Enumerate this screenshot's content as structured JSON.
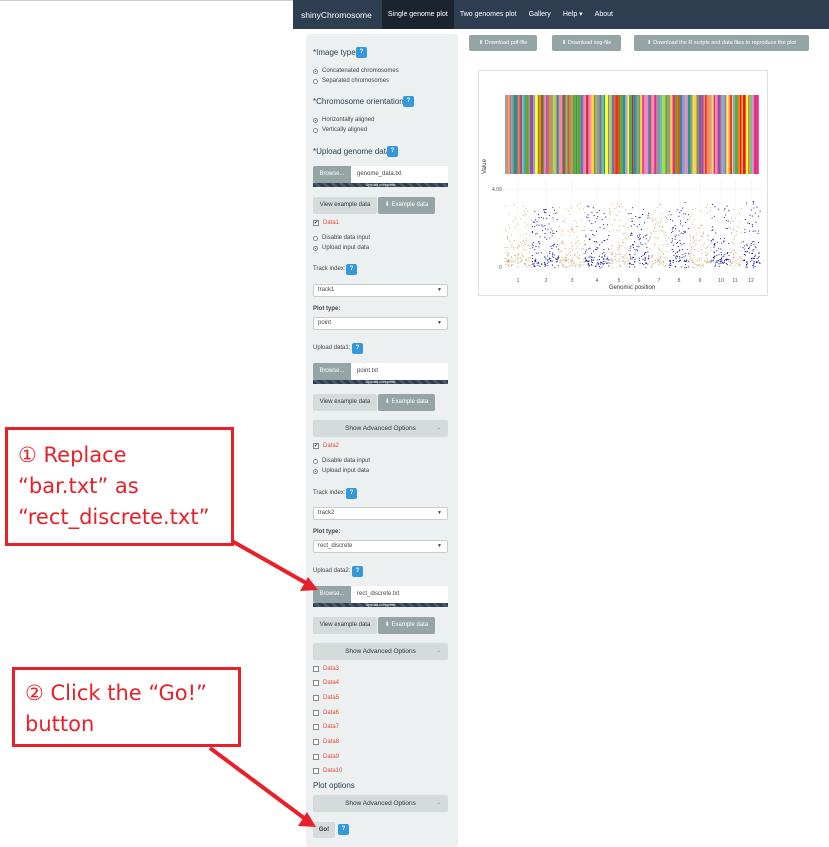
{
  "navbar": {
    "brand": "shinyChromosome",
    "items": [
      "Single genome plot",
      "Two genomes plot",
      "Gallery",
      "Help ▾",
      "About"
    ]
  },
  "sidebar": {
    "image_type_label": "*Image type",
    "image_type_options": [
      "Concatenated chromosomes",
      "Separated chromosomes"
    ],
    "orientation_label": "*Chromosome orientation",
    "orientation_options": [
      "Horizontally aligned",
      "Vertically aligned"
    ],
    "upload_genome_label": "*Upload genome data",
    "genome_file": "genome_data.txt",
    "browse_label": "Browse...",
    "upload_complete": "Upload complete",
    "view_example": "View example data",
    "example_data": "⬇ Example data",
    "data1_label": "Data1",
    "disable_input": "Disable data input",
    "upload_input": "Upload input data",
    "track_index_label": "Track index:",
    "track1": "track1",
    "plot_type_label": "Plot type:",
    "plot_type1": "point",
    "upload_data1_label": "Upload data1:",
    "upload_data1_file": "point.txt",
    "advanced_options": "Show Advanced Options",
    "data2_label": "Data2",
    "track2": "track2",
    "plot_type2": "rect_discrete",
    "upload_data2_label": "Upload data2:",
    "upload_data2_file": "rect_discrete.txt",
    "other_data": [
      "Data3",
      "Data4",
      "Data5",
      "Data6",
      "Data7",
      "Data8",
      "Data9",
      "Data10"
    ],
    "plot_options_label": "Plot options",
    "go_label": "Go!",
    "help_glyph": "?"
  },
  "downloads": {
    "pdf": "⬇ Download pdf-file",
    "svg": "⬇ Download svg-file",
    "scripts": "⬇ Download the R scripts and data files to reproduce the plot"
  },
  "plot": {
    "ylabel": "Value",
    "xlabel": "Genomic position",
    "ytick_top": "4.09",
    "ytick_bottom": "0",
    "xticks": [
      "1",
      "2",
      "3",
      "4",
      "5",
      "6",
      "7",
      "8",
      "9",
      "10",
      "11",
      "12"
    ]
  },
  "annotations": {
    "step1_lines": [
      "① Replace",
      "“bar.txt” as",
      "“rect_discrete.txt”"
    ],
    "step2_lines": [
      "② Click the “Go!”",
      "button"
    ]
  },
  "colors": {
    "navbar": "#2c3e50",
    "accent_blue": "#3498db",
    "annotation_red": "#e8202a",
    "point_blue": "#00008b",
    "point_tan": "#d2a872"
  }
}
